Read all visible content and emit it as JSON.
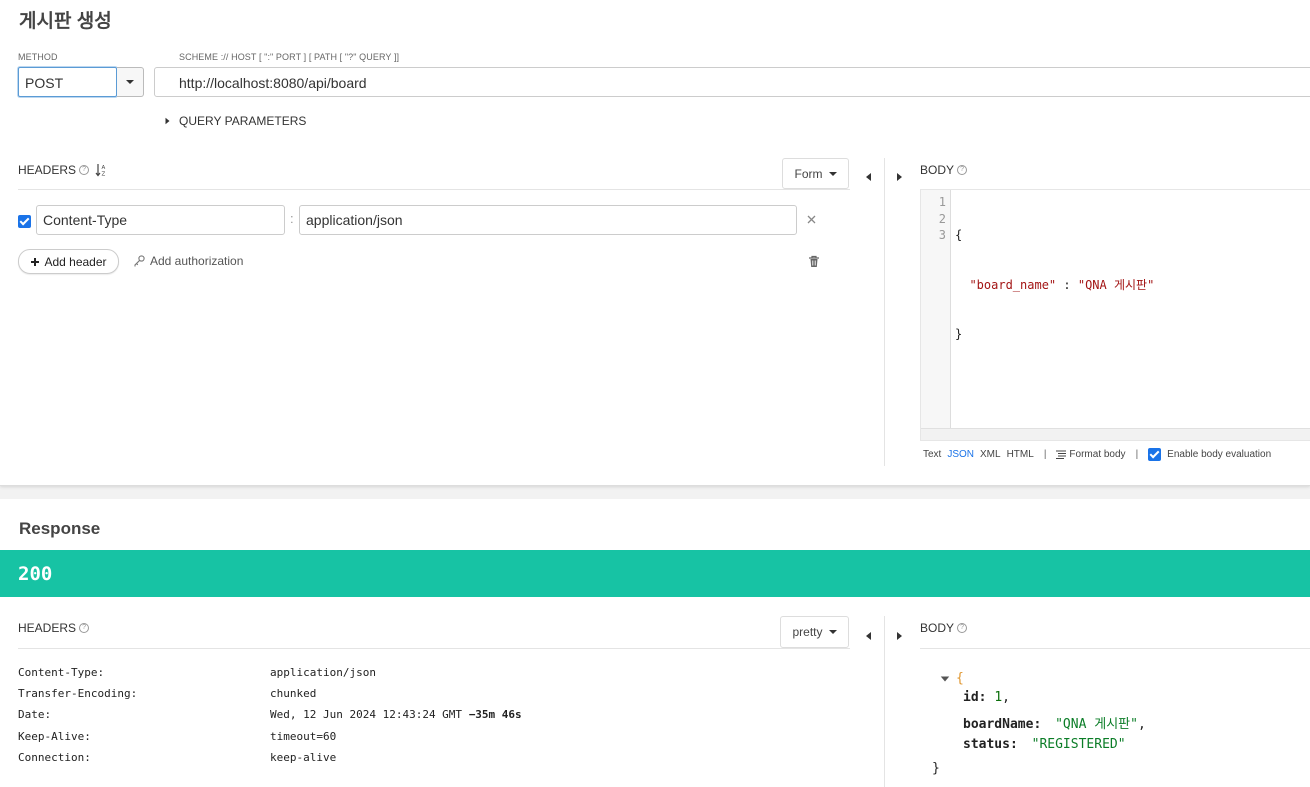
{
  "request": {
    "title": "게시판 생성",
    "method_label": "METHOD",
    "method_value": "POST",
    "url_label": "SCHEME :// HOST [ \":\" PORT ] [ PATH [ \"?\" QUERY ]]",
    "url_value": "http://localhost:8080/api/board",
    "query_params_label": "QUERY PARAMETERS",
    "headers_label": "HEADERS",
    "headers_mode": "Form",
    "header_rows": [
      {
        "enabled": true,
        "name": "Content-Type",
        "separator": ":",
        "value": "application/json"
      }
    ],
    "add_header_label": "Add header",
    "add_auth_label": "Add authorization",
    "body_label": "BODY",
    "body_lines": [
      "1",
      "2",
      "3"
    ],
    "body_code": {
      "line1": "{",
      "line2_key": "\"board_name\"",
      "line2_sep": " : ",
      "line2_val": "\"QNA 게시판\"",
      "line3": "}"
    },
    "body_formats": [
      "Text",
      "JSON",
      "XML",
      "HTML"
    ],
    "body_format_active": "JSON",
    "format_sep": "|",
    "format_body_label": "Format body",
    "enable_eval_label": "Enable body evaluation",
    "enable_eval_checked": true
  },
  "response": {
    "title": "Response",
    "status_code": "200",
    "status_color": "#17c3a4",
    "headers_label": "HEADERS",
    "headers_mode": "pretty",
    "body_label": "BODY",
    "headers": [
      {
        "name": "Content-Type:",
        "value": "application/json"
      },
      {
        "name": "Transfer-Encoding:",
        "value": "chunked"
      },
      {
        "name": "Date:",
        "value": "Wed, 12 Jun 2024 12:43:24 GMT",
        "extra": "−35m 46s"
      },
      {
        "name": "Keep-Alive:",
        "value": "timeout=60"
      },
      {
        "name": "Connection:",
        "value": "keep-alive"
      }
    ],
    "body": {
      "open": "{",
      "close": "}",
      "fields": [
        {
          "key": "id:",
          "value": "1",
          "comma": ","
        },
        {
          "key": "boardName:",
          "value": "\"QNA 게시판\"",
          "comma": ","
        },
        {
          "key": "status:",
          "value": "\"REGISTERED\"",
          "comma": ""
        }
      ]
    }
  },
  "icons": [
    "sort-az-icon",
    "help-icon",
    "plus-icon",
    "key-icon",
    "close-icon",
    "trash-icon",
    "format-body-icon",
    "collapse-left-icon",
    "expand-right-icon"
  ]
}
